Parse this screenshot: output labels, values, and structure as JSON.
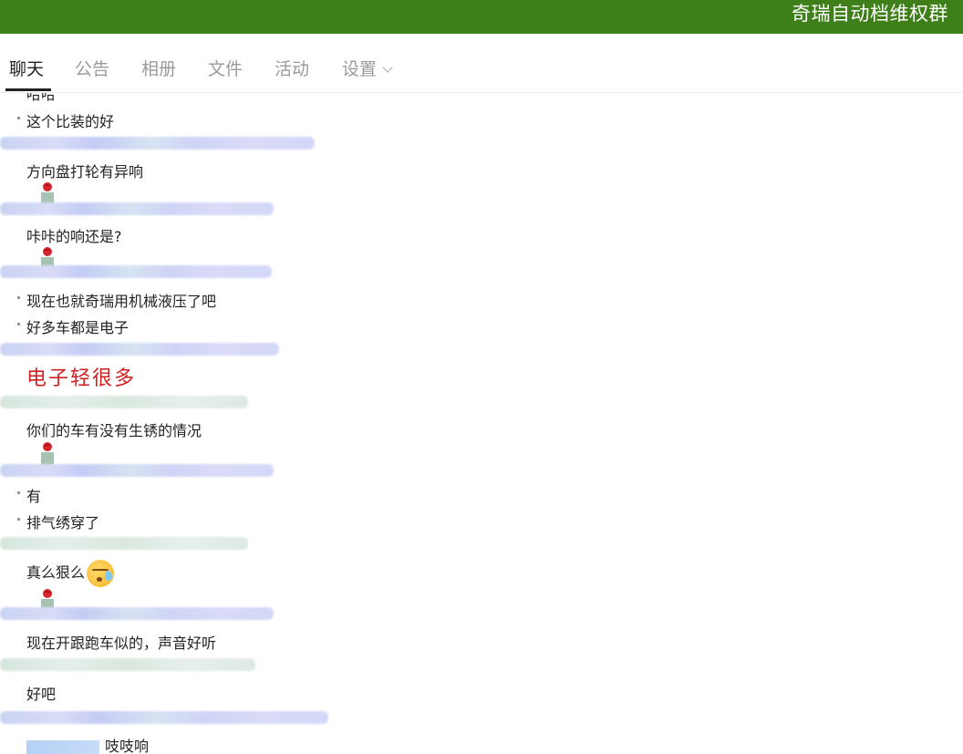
{
  "header": {
    "group_title": "奇瑞自动档维权群"
  },
  "tabs": [
    {
      "label": "聊天",
      "active": true
    },
    {
      "label": "公告"
    },
    {
      "label": "相册"
    },
    {
      "label": "文件"
    },
    {
      "label": "活动"
    },
    {
      "label": "设置"
    }
  ],
  "messages": {
    "m0": "哈哈",
    "m1": "这个比装的好",
    "m2": "方向盘打轮有异响",
    "m3": "咔咔的响还是?",
    "m4": "现在也就奇瑞用机械液压了吧",
    "m5": "好多车都是电子",
    "m6": "电子轻很多",
    "m7": "你们的车有没有生锈的情况",
    "m8": "有",
    "m9": "排气绣穿了",
    "m10": "真么狠么",
    "m11": "现在开跟跑车似的，声音好听",
    "m12": "好吧",
    "m13": "吱吱响"
  },
  "emoji": {
    "m10": "sweat-face-icon"
  },
  "sticker": "rose-icon",
  "colors": {
    "header_bg": "#3f7f19",
    "red_text": "#d21e1e"
  }
}
